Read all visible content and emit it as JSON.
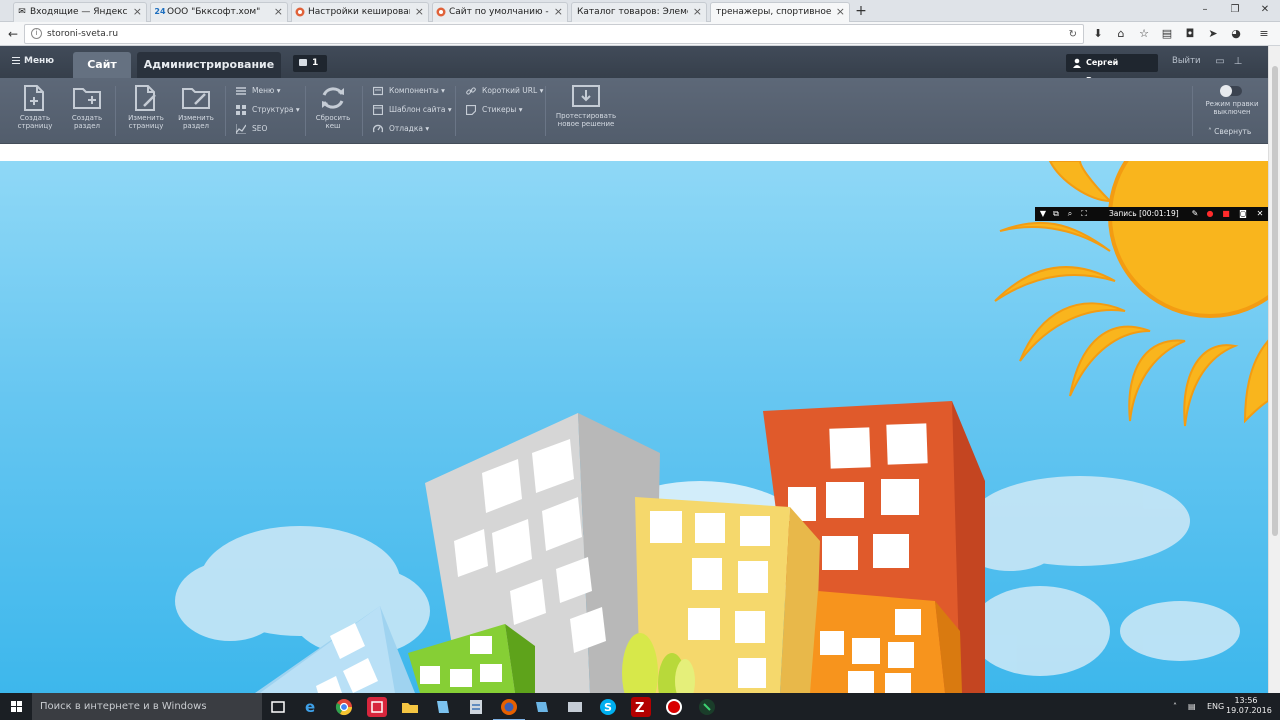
{
  "browser": {
    "tabs": [
      {
        "label": "Входящие — Яндекс.Почта",
        "icon": "mail-icon"
      },
      {
        "label": "ООО \"Бкксофт.хом\"",
        "icon": "bitrix24-icon",
        "icon_text": "24"
      },
      {
        "label": "Настройки кеширования...",
        "icon": "bitrix-icon"
      },
      {
        "label": "Сайт по умолчанию - Гл...",
        "icon": "bitrix-icon"
      },
      {
        "label": "Каталог товаров: Элементы -...",
        "icon": "none"
      },
      {
        "label": "тренажеры, спортивное обо...",
        "icon": "none",
        "active": true
      }
    ],
    "url": "storoni-sveta.ru"
  },
  "panel": {
    "menu_label": "Меню",
    "tab_site": "Сайт",
    "tab_admin": "Администрирование",
    "notifications_count": "1",
    "user_name": "Сергей Романов",
    "logout_label": "Выйти",
    "buttons": {
      "create_page": "Создать\nстраницу",
      "create_section": "Создать\nраздел",
      "edit_page": "Изменить\nстраницу",
      "edit_section": "Изменить\nраздел",
      "reset_cache": "Сбросить\nкеш",
      "test_solution": "Протестировать\nновое решение"
    },
    "small_buttons": {
      "menu": "Меню",
      "structure": "Структура",
      "seo": "SEO",
      "components": "Компоненты",
      "site_template": "Шаблон сайта",
      "debug": "Отладка",
      "short_url": "Короткий URL",
      "stickers": "Стикеры"
    },
    "edit_mode_label": "Режим правки\nвыключен",
    "collapse_label": "Свернуть"
  },
  "recorder": {
    "status": "Запись [00:01:19]"
  },
  "taskbar": {
    "search_placeholder": "Поиск в интернете и в Windows",
    "language": "ENG",
    "time": "13:56",
    "date": "19.07.2016"
  },
  "colors": {
    "panel_dark": "#414b59",
    "panel_light": "#5d6878",
    "sky": "#66c6f1",
    "sun": "#f9b51d",
    "building_orange": "#e05a2b",
    "building_yellow": "#f5d86c",
    "building_gray": "#c9c9c9",
    "building_green": "#7dc62b"
  }
}
